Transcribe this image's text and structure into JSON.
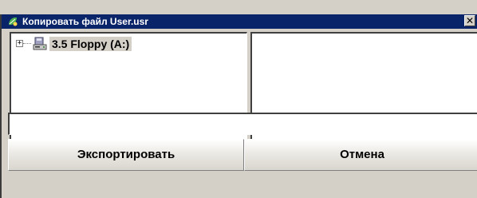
{
  "window": {
    "title": "Копировать файл User.usr",
    "close_glyph": "✕",
    "app_icon": "app-leaf-icon"
  },
  "tree": {
    "items": [
      {
        "expander": "+",
        "icon": "floppy-drive-icon",
        "label": "3.5 Floppy (A:)",
        "selected": true
      }
    ]
  },
  "path_field": {
    "value": "",
    "placeholder": ""
  },
  "buttons": {
    "export_label": "Экспортировать",
    "cancel_label": "Отмена"
  },
  "colors": {
    "titlebar": "#0a246a",
    "face": "#d4d0c8",
    "pane": "#ffffff"
  }
}
